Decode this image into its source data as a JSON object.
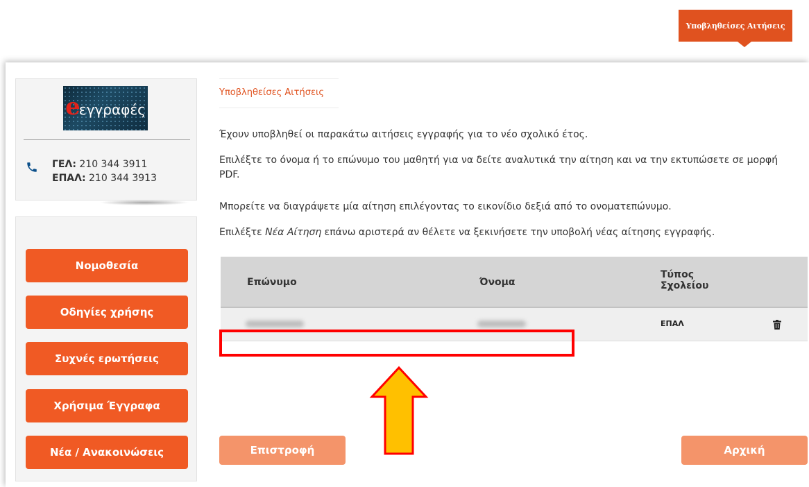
{
  "header": {
    "active_tab_label": "Υποβληθείσες Αιτήσεις"
  },
  "sidebar": {
    "logo": {
      "e": "e",
      "text": "εγγραφές"
    },
    "contacts": [
      {
        "label": "ΓΕΛ:",
        "phone": "210 344 3911"
      },
      {
        "label": "ΕΠΑΛ:",
        "phone": "210 344 3913"
      }
    ],
    "nav": [
      "Νομοθεσία",
      "Οδηγίες χρήσης",
      "Συχνές ερωτήσεις",
      "Χρήσιμα Έγγραφα",
      "Νέα / Ανακοινώσεις"
    ]
  },
  "main": {
    "breadcrumb": "Υποβληθείσες Αιτήσεις",
    "paragraph_1": "Έχουν υποβληθεί οι παρακάτω αιτήσεις εγγραφής για το νέο σχολικό έτος.",
    "paragraph_2": "Επιλέξτε το όνομα ή το επώνυμο του μαθητή για να δείτε αναλυτικά την αίτηση και να την εκτυπώσετε σε μορφή PDF.",
    "paragraph_3": "Μπορείτε να διαγράψετε μία αίτηση επιλέγοντας το εικονίδιο δεξιά από το ονοματεπώνυμο.",
    "paragraph_4": {
      "before": "Επιλέξτε ",
      "emphasis": "Νέα Αίτηση",
      "after": " επάνω αριστερά αν θέλετε να ξεκινήσετε την υποβολή νέας αίτησης εγγραφής."
    },
    "table": {
      "headers": {
        "surname": "Επώνυμο",
        "name": "Όνομα",
        "school_type_line1": "Τύπος",
        "school_type_line2": "Σχολείου"
      },
      "rows": [
        {
          "surname": "",
          "name": "",
          "school_type": "ΕΠΑΛ"
        }
      ]
    },
    "buttons": {
      "back": "Επιστροφή",
      "home": "Αρχική"
    }
  },
  "colors": {
    "accent": "#f05a24",
    "accent_light": "#f4946a",
    "highlight": "#ff0000",
    "arrow_fill": "#ffc000"
  }
}
